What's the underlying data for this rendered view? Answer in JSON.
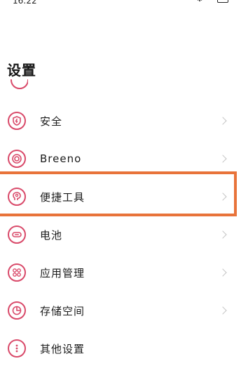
{
  "status_bar": {
    "time": "16:22",
    "icons": [
      "bluetooth-icon",
      "wifi-icon",
      "battery-icon"
    ]
  },
  "page": {
    "title": "设置"
  },
  "settings": {
    "items": [
      {
        "label": "安全",
        "icon": "security-icon",
        "has_chevron": true
      },
      {
        "label": "Breeno",
        "icon": "breeno-icon",
        "has_chevron": true
      },
      {
        "label": "便捷工具",
        "icon": "convenience-tools-icon",
        "has_chevron": true,
        "highlighted": true
      },
      {
        "label": "电池",
        "icon": "battery-icon",
        "has_chevron": true
      },
      {
        "label": "应用管理",
        "icon": "app-management-icon",
        "has_chevron": true
      },
      {
        "label": "存储空间",
        "icon": "storage-icon",
        "has_chevron": true
      },
      {
        "label": "其他设置",
        "icon": "other-settings-icon",
        "has_chevron": false
      }
    ]
  },
  "colors": {
    "accent": "#d94a6a",
    "highlight": "#e8733a",
    "chevron": "#c4c4c4"
  }
}
